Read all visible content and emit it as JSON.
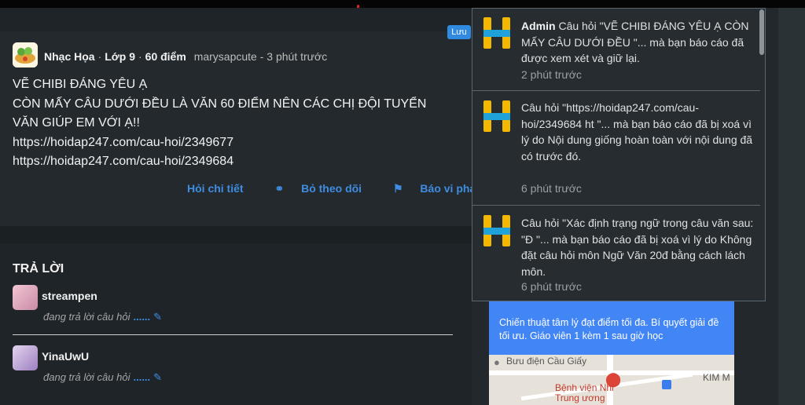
{
  "save_button": "Lưu",
  "question": {
    "subject": "Nhạc Họa",
    "grade": "Lớp 9",
    "points": "60 điểm",
    "author": "marysapcute",
    "time": "3 phút trước",
    "lines": [
      "VẼ CHIBI ĐÁNG YÊU Ạ",
      "CÒN MẤY CÂU DƯỚI ĐỀU LÀ VĂN 60 ĐIỂM NÊN CÁC CHỊ ĐỘI TUYỂN",
      "VĂN GIÚP EM VỚI Ạ!!",
      "https://hoidap247.com/cau-hoi/2349677",
      "https://hoidap247.com/cau-hoi/2349684"
    ],
    "actions": {
      "detail": "Hỏi chi tiết",
      "unfollow": "Bỏ theo dõi",
      "report": "Báo vi phạm"
    }
  },
  "answers": {
    "title": "TRẢ LỜI",
    "items": [
      {
        "name": "streampen",
        "status": "đang trả lời câu hỏi",
        "dots": "......"
      },
      {
        "name": "YinaUwU",
        "status": "đang trả lời câu hỏi",
        "dots": "......"
      }
    ]
  },
  "notifications": [
    {
      "sender": "Admin",
      "text": "Câu hỏi \"VẼ CHIBI ĐÁNG YÊU Ạ CÒN MẤY CÂU DƯỚI ĐỀU \"... mà bạn báo cáo đã được xem xét và giữ lại.",
      "time": "2 phút trước"
    },
    {
      "sender": "",
      "text": "Câu hỏi \"https://hoidap247.com/cau-hoi/2349684 ht \"... mà bạn báo cáo đã bị xoá vì lý do Nội dung giống hoàn toàn với nội dung đã có trước đó.",
      "time": "6 phút trước"
    },
    {
      "sender": "",
      "text": "Câu hỏi \"Xác định trạng ngữ trong câu văn sau: \"Đ \"... mà bạn báo cáo đã bị xoá vì lý do Không đặt câu hỏi môn Ngữ Văn 20đ bằng cách lách môn.",
      "time": "6 phút trước"
    }
  ],
  "ad": {
    "text": "Chiến thuật tâm lý đạt điểm tối đa. Bí quyết giải đề tối ưu. Giáo viên 1 kèm 1 sau giờ học",
    "map_labels": [
      "Bưu điện Cầu Giấy",
      "Bệnh viện Nhi Trung ương",
      "KIM M"
    ]
  },
  "colors": {
    "accent": "#3f8de0",
    "logo_yellow": "#f5b800",
    "logo_blue": "#1fa1d9"
  }
}
